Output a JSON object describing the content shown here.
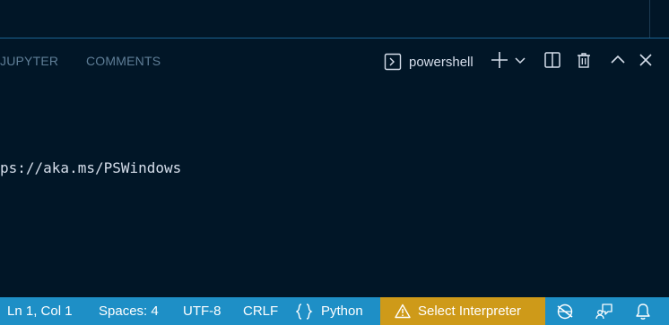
{
  "panel": {
    "tabs": [
      {
        "label": "JUPYTER"
      },
      {
        "label": "COMMENTS"
      }
    ],
    "terminal_name": "powershell",
    "actions": [
      "new-terminal-icon",
      "chevron-down-icon",
      "split-terminal-icon",
      "trash-icon",
      "chevron-up-icon",
      "close-icon"
    ]
  },
  "terminal": {
    "line": "ps://aka.ms/PSWindows"
  },
  "statusbar": {
    "position": "Ln 1, Col 1",
    "spaces": "Spaces: 4",
    "encoding": "UTF-8",
    "eol": "CRLF",
    "language": "Python",
    "interpreter": "Select Interpreter",
    "colors": {
      "background": "#1e8fc6",
      "warning_background": "#ce9a19"
    }
  },
  "colors": {
    "background": "#011627",
    "panel_border": "#1c6391",
    "tab_inactive": "#5f7e97",
    "text": "#d6deeb"
  }
}
